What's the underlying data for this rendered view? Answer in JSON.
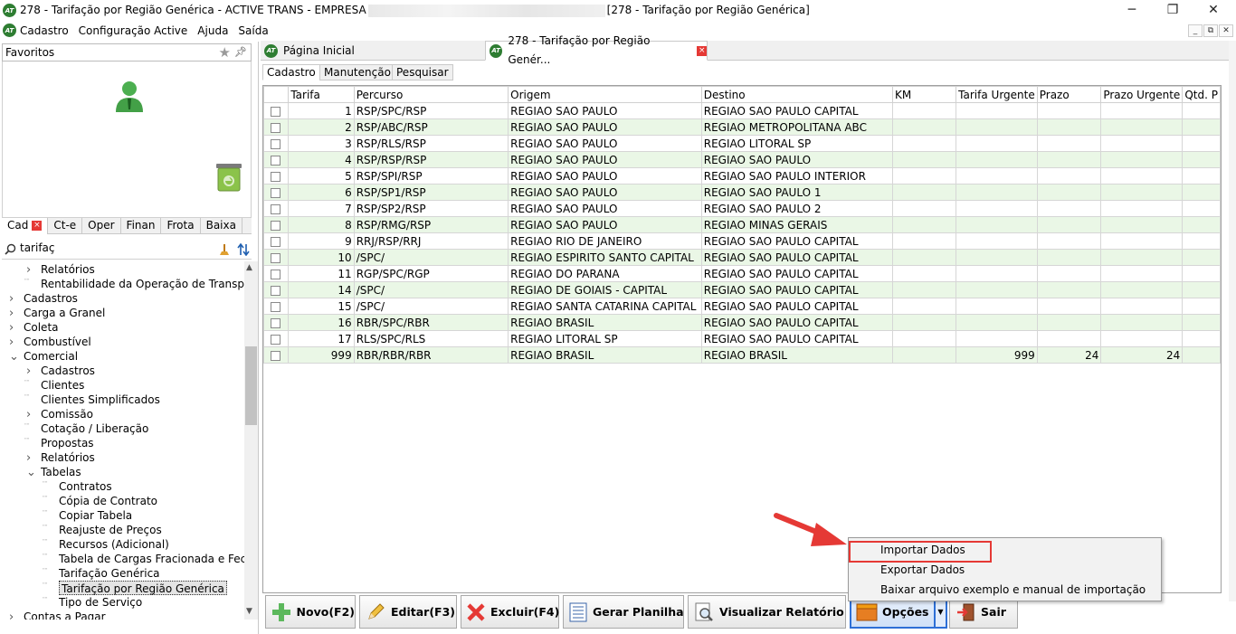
{
  "window": {
    "title_prefix": "278 - Tarifação por Região Genérica - ACTIVE TRANS - EMPRESA",
    "title_suffix": "[278 - Tarifação por Região Genérica]",
    "logo_text": "AT",
    "min_label": "─",
    "max_label": "❐",
    "close_label": "✕"
  },
  "menubar": {
    "items": [
      "Cadastro",
      "Configuração Active",
      "Ajuda",
      "Saída"
    ]
  },
  "mdi_controls": [
    "_",
    "⧉",
    "✕"
  ],
  "left": {
    "favorites_label": "Favoritos",
    "tabs": [
      "Cad",
      "Ct-e",
      "Oper",
      "Finan",
      "Frota",
      "Baixa"
    ],
    "search_value": "tarifaç",
    "tree": [
      {
        "label": "Relatórios",
        "level": 2,
        "arrow": ">"
      },
      {
        "label": "Rentabilidade da Operação de Transpor",
        "level": 2,
        "arrow": ""
      },
      {
        "label": "Cadastros",
        "level": 1,
        "arrow": ">"
      },
      {
        "label": "Carga a Granel",
        "level": 1,
        "arrow": ">"
      },
      {
        "label": "Coleta",
        "level": 1,
        "arrow": ">"
      },
      {
        "label": "Combustível",
        "level": 1,
        "arrow": ">"
      },
      {
        "label": "Comercial",
        "level": 1,
        "arrow": "v"
      },
      {
        "label": "Cadastros",
        "level": 2,
        "arrow": ">"
      },
      {
        "label": "Clientes",
        "level": 2,
        "arrow": ""
      },
      {
        "label": "Clientes Simplificados",
        "level": 2,
        "arrow": ""
      },
      {
        "label": "Comissão",
        "level": 2,
        "arrow": ">"
      },
      {
        "label": "Cotação / Liberação",
        "level": 2,
        "arrow": ""
      },
      {
        "label": "Propostas",
        "level": 2,
        "arrow": ""
      },
      {
        "label": "Relatórios",
        "level": 2,
        "arrow": ">"
      },
      {
        "label": "Tabelas",
        "level": 2,
        "arrow": "v"
      },
      {
        "label": "Contratos",
        "level": 3,
        "arrow": ""
      },
      {
        "label": "Cópia de Contrato",
        "level": 3,
        "arrow": ""
      },
      {
        "label": "Copiar Tabela",
        "level": 3,
        "arrow": ""
      },
      {
        "label": "Reajuste de Preços",
        "level": 3,
        "arrow": ""
      },
      {
        "label": "Recursos (Adicional)",
        "level": 3,
        "arrow": ""
      },
      {
        "label": "Tabela de Cargas Fracionada e Fech",
        "level": 3,
        "arrow": ""
      },
      {
        "label": "Tarifação Genérica",
        "level": 3,
        "arrow": ""
      },
      {
        "label": "Tarifação por Região Genérica",
        "level": 3,
        "arrow": "",
        "selected": true
      },
      {
        "label": "Tipo de Serviço",
        "level": 3,
        "arrow": ""
      },
      {
        "label": "Contas a Pagar",
        "level": 1,
        "arrow": ">"
      }
    ]
  },
  "doc_tabs": [
    "Página Inicial",
    "278 - Tarifação por Região Genér..."
  ],
  "sub_tabs": [
    "Cadastro",
    "Manutenção",
    "Pesquisar"
  ],
  "grid": {
    "columns": [
      "",
      "Tarifa",
      "Percurso",
      "Origem",
      "Destino",
      "KM",
      "Tarifa Urgente",
      "Prazo",
      "Prazo Urgente",
      "Qtd. P"
    ],
    "rows": [
      [
        "1",
        "RSP/SPC/RSP",
        "REGIAO SAO PAULO",
        "REGIAO SAO PAULO CAPITAL",
        "",
        "",
        "",
        "",
        ""
      ],
      [
        "2",
        "RSP/ABC/RSP",
        "REGIAO SAO PAULO",
        "REGIAO METROPOLITANA ABC",
        "",
        "",
        "",
        "",
        ""
      ],
      [
        "3",
        "RSP/RLS/RSP",
        "REGIAO SAO PAULO",
        "REGIAO LITORAL SP",
        "",
        "",
        "",
        "",
        ""
      ],
      [
        "4",
        "RSP/RSP/RSP",
        "REGIAO SAO PAULO",
        "REGIAO SAO PAULO",
        "",
        "",
        "",
        "",
        ""
      ],
      [
        "5",
        "RSP/SPI/RSP",
        "REGIAO SAO PAULO",
        "REGIAO SAO PAULO INTERIOR",
        "",
        "",
        "",
        "",
        ""
      ],
      [
        "6",
        "RSP/SP1/RSP",
        "REGIAO SAO PAULO",
        "REGIAO SAO PAULO 1",
        "",
        "",
        "",
        "",
        ""
      ],
      [
        "7",
        "RSP/SP2/RSP",
        "REGIAO SAO PAULO",
        "REGIAO SAO PAULO 2",
        "",
        "",
        "",
        "",
        ""
      ],
      [
        "8",
        "RSP/RMG/RSP",
        "REGIAO SAO PAULO",
        "REGIAO MINAS GERAIS",
        "",
        "",
        "",
        "",
        ""
      ],
      [
        "9",
        "RRJ/RSP/RRJ",
        "REGIAO RIO DE JANEIRO",
        "REGIAO SAO PAULO CAPITAL",
        "",
        "",
        "",
        "",
        ""
      ],
      [
        "10",
        "/SPC/",
        "REGIAO ESPIRITO SANTO CAPITAL",
        "REGIAO SAO PAULO CAPITAL",
        "",
        "",
        "",
        "",
        ""
      ],
      [
        "11",
        "RGP/SPC/RGP",
        "REGIAO DO PARANA",
        "REGIAO SAO PAULO CAPITAL",
        "",
        "",
        "",
        "",
        ""
      ],
      [
        "14",
        "/SPC/",
        "REGIAO DE GOIAIS - CAPITAL",
        "REGIAO SAO PAULO CAPITAL",
        "",
        "",
        "",
        "",
        ""
      ],
      [
        "15",
        "/SPC/",
        "REGIAO SANTA CATARINA CAPITAL",
        "REGIAO SAO PAULO CAPITAL",
        "",
        "",
        "",
        "",
        ""
      ],
      [
        "16",
        "RBR/SPC/RBR",
        "REGIAO BRASIL",
        "REGIAO SAO PAULO CAPITAL",
        "",
        "",
        "",
        "",
        ""
      ],
      [
        "17",
        "RLS/SPC/RLS",
        "REGIAO LITORAL SP",
        "REGIAO SAO PAULO CAPITAL",
        "",
        "",
        "",
        "",
        ""
      ],
      [
        "999",
        "RBR/RBR/RBR",
        "REGIAO BRASIL",
        "REGIAO BRASIL",
        "",
        "999",
        "24",
        "24",
        ""
      ]
    ]
  },
  "toolbar": {
    "novo": "Novo(F2)",
    "editar": "Editar(F3)",
    "excluir": "Excluir(F4)",
    "planilha": "Gerar Planilha",
    "relatorio": "Visualizar Relatório",
    "opcoes": "Opções",
    "sair": "Sair"
  },
  "dropdown": {
    "items": [
      "Importar Dados",
      "Exportar Dados",
      "Baixar arquivo exemplo e manual de importação"
    ]
  },
  "colors": {
    "alt_row": "#eaf7e6",
    "highlight": "#e53935",
    "accent": "#2d6fd6"
  }
}
